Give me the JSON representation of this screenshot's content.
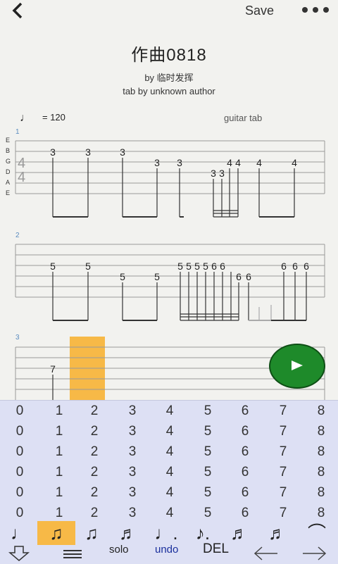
{
  "header": {
    "save_label": "Save"
  },
  "song": {
    "title": "作曲0818",
    "by": "by 临时发挥",
    "tab_by": "tab by unknown author",
    "tempo": "= 120",
    "instrument": "guitar tab"
  },
  "score": {
    "string_names": [
      "E",
      "B",
      "G",
      "D",
      "A",
      "E"
    ],
    "time_signature": "4/4",
    "systems": [
      {
        "number": "1",
        "notes": [
          "3",
          "3",
          "3",
          "3",
          "3",
          "3",
          "3",
          "4",
          "4",
          "4",
          "4"
        ]
      },
      {
        "number": "2",
        "notes": [
          "5",
          "5",
          "5",
          "5",
          "5",
          "5",
          "5",
          "5",
          "6",
          "6",
          "6",
          "6",
          "6",
          "6",
          "6"
        ]
      },
      {
        "number": "3",
        "notes": [
          "7"
        ]
      }
    ]
  },
  "fret_keyboard": {
    "rows": 6,
    "frets": [
      "0",
      "1",
      "2",
      "3",
      "4",
      "5",
      "6",
      "7",
      "8"
    ]
  },
  "note_durations": [
    {
      "name": "quarter-note",
      "glyph": "♩",
      "selected": false
    },
    {
      "name": "eighth-note",
      "glyph": "♫",
      "selected": true
    },
    {
      "name": "eighth-note-pair",
      "glyph": "♫",
      "selected": false
    },
    {
      "name": "sixteenth-note",
      "glyph": "♬",
      "selected": false
    },
    {
      "name": "dotted-quarter",
      "glyph": "♩.",
      "selected": false
    },
    {
      "name": "dotted-eighth",
      "glyph": "♪.",
      "selected": false
    },
    {
      "name": "triplet",
      "glyph": "♬",
      "selected": false
    },
    {
      "name": "sixteenth-group",
      "glyph": "♬",
      "selected": false
    },
    {
      "name": "tie",
      "glyph": "⌒",
      "selected": false
    }
  ],
  "actions": {
    "solo": "solo",
    "undo": "undo",
    "del": "DEL"
  },
  "colors": {
    "accent": "#f7b947",
    "play": "#1e8a2a",
    "keyboard": "#dde0f4"
  }
}
